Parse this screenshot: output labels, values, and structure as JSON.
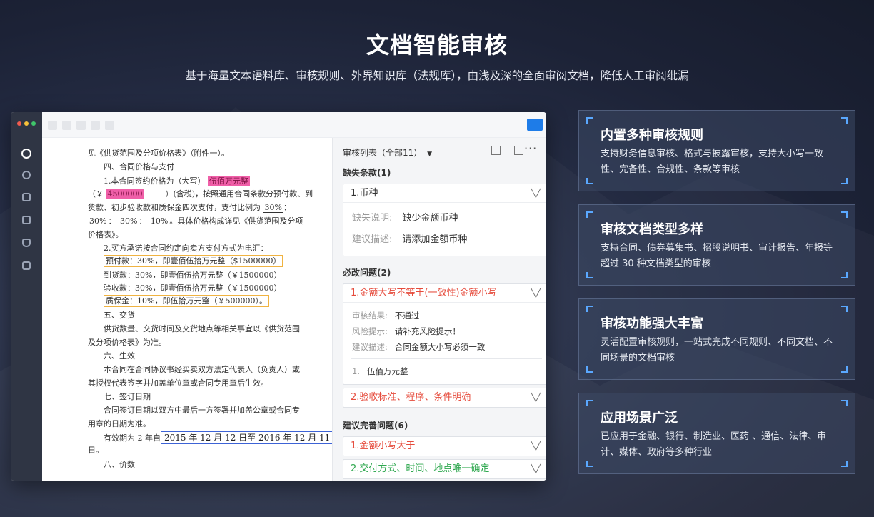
{
  "hero": {
    "title": "文档智能审核",
    "subtitle": "基于海量文本语料库、审核规则、外界知识库（法规库），由浅及深的全面审阅文档，降低人工审阅纰漏"
  },
  "window": {
    "dot_colors": [
      "#f15b4f",
      "#f6c13a",
      "#3fc56a"
    ],
    "accent": "#1e7ce8"
  },
  "document": {
    "lines": [
      "见《供货范围及分项价格表》（附件一）。",
      "四、合同价格与支付",
      "1.本合同签约价格为（大写）",
      "伍佰万元整",
      "（￥",
      "4500000",
      "）(含税)，按照通用合同条款分预付款、到",
      "货款、初步验收款和质保金四次支付，支付比例为",
      "30%",
      "：",
      "30%",
      "：",
      "30%",
      "：",
      "10%",
      "。具体价格构成详见《供货范围及分项",
      "价格表》。",
      "2.买方承诺按合同约定向卖方支付方式为电汇：",
      "预付款：30%，即壹佰伍拾万元整（$1500000）",
      "到货款：30%，即壹佰伍拾万元整（￥1500000）",
      "验收款：30%，即壹佰伍拾万元整（￥1500000）",
      "质保金：10%，即伍拾万元整（￥500000）。",
      "五、交货",
      "供货数量、交货时间及交货地点等相关事宜以《供货范围",
      "及分项价格表》为准。",
      "六、生效",
      "本合同在合同协议书经买卖双方法定代表人（负责人）或",
      "其授权代表签字并加盖单位章或合同专用章后生效。",
      "七、签订日期",
      "合同签订日期以双方中最后一方签署并加盖公章或合同专",
      "用章的日期为准。",
      "有效期为 2 年自",
      "2015 年 12 月 12 日至 2016 年 12 月 11",
      "日。",
      "八、价数"
    ]
  },
  "review": {
    "header": "审核列表（全部11）",
    "more": "···",
    "missing": {
      "title": "缺失条款(1)",
      "item": {
        "label": "1.币种",
        "desc_key": "缺失说明:",
        "desc_val": "缺少金额币种",
        "sugg_key": "建议描述:",
        "sugg_val": "请添加金额币种"
      }
    },
    "must": {
      "title": "必改问题(2)",
      "item1": {
        "label": "1.金额大写不等于(一致性)金额小写",
        "result_key": "审核结果:",
        "result_val": "不通过",
        "risk_key": "风险提示:",
        "risk_val": "请补充风险提示！",
        "sugg_key": "建议描述:",
        "sugg_val": "合同金额大小写必须一致",
        "ref_num": "1.",
        "ref_text": "伍佰万元整"
      },
      "item2": {
        "label": "2.验收标准、程序、条件明确"
      }
    },
    "suggest": {
      "title": "建议完善问题(6)",
      "item1": {
        "label": "1.金额小写大于"
      },
      "item2": {
        "label": "2.交付方式、时间、地点唯一确定"
      }
    }
  },
  "features": [
    {
      "title": "内置多种审核规则",
      "desc": "支持财务信息审核、格式与披露审核，支持大小写一致性、完备性、合规性、条款等审核"
    },
    {
      "title": "审核文档类型多样",
      "desc": "支持合同、债券募集书、招股说明书、审计报告、年报等超过 30 种文档类型的审核"
    },
    {
      "title": "审核功能强大丰富",
      "desc": "灵活配置审核规则，一站式完成不同规则、不同文档、不同场景的文档审核"
    },
    {
      "title": "应用场景广泛",
      "desc": "已应用于金融、银行、制造业、医药 、通信、法律、审计、媒体、政府等多种行业"
    }
  ]
}
